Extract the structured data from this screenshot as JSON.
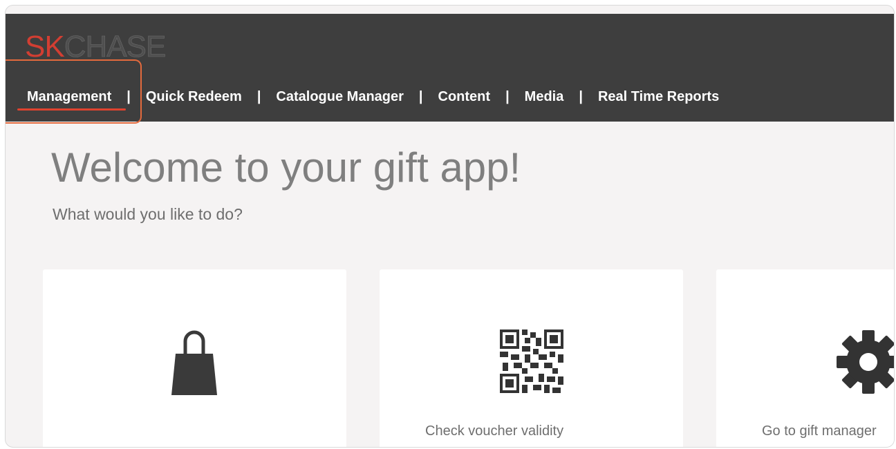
{
  "logo": {
    "part1": "SK",
    "part2": "CHASE"
  },
  "nav": {
    "items": [
      {
        "label": "Management"
      },
      {
        "label": "Quick Redeem"
      },
      {
        "label": "Catalogue Manager"
      },
      {
        "label": "Content"
      },
      {
        "label": "Media"
      },
      {
        "label": "Real Time Reports"
      }
    ],
    "separator": "|",
    "active_color": "#e0432f"
  },
  "welcome": {
    "title": "Welcome to your gift app!",
    "subtitle": "What would you like to do?"
  },
  "cards": [
    {
      "icon": "shopping-bag-icon",
      "label": ""
    },
    {
      "icon": "qr-code-icon",
      "label": "Check voucher validity"
    },
    {
      "icon": "gear-icon",
      "label": "Go to gift manager"
    }
  ],
  "colors": {
    "topbar": "#3e3e3e",
    "accent": "#d23e32",
    "highlight": "#e46a3d"
  }
}
